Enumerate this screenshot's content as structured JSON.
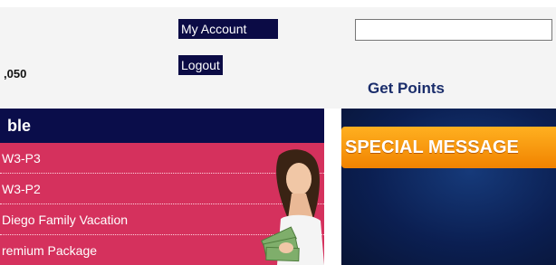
{
  "header": {
    "points_text": ",050",
    "my_account_label": "My Account",
    "logout_label": "Logout",
    "search_value": "",
    "get_points_label": "Get Points"
  },
  "panel": {
    "title": "ble",
    "items": [
      {
        "label": "W3-P3"
      },
      {
        "label": "W3-P2"
      },
      {
        "label": "Diego Family Vacation"
      },
      {
        "label": "remium Package"
      }
    ]
  },
  "promo": {
    "message": "SPECIAL MESSAGE"
  },
  "colors": {
    "nav_dark": "#0a0d4a",
    "list_pink": "#d5315d",
    "orange": "#f18300",
    "link_blue": "#1a2d6b"
  }
}
